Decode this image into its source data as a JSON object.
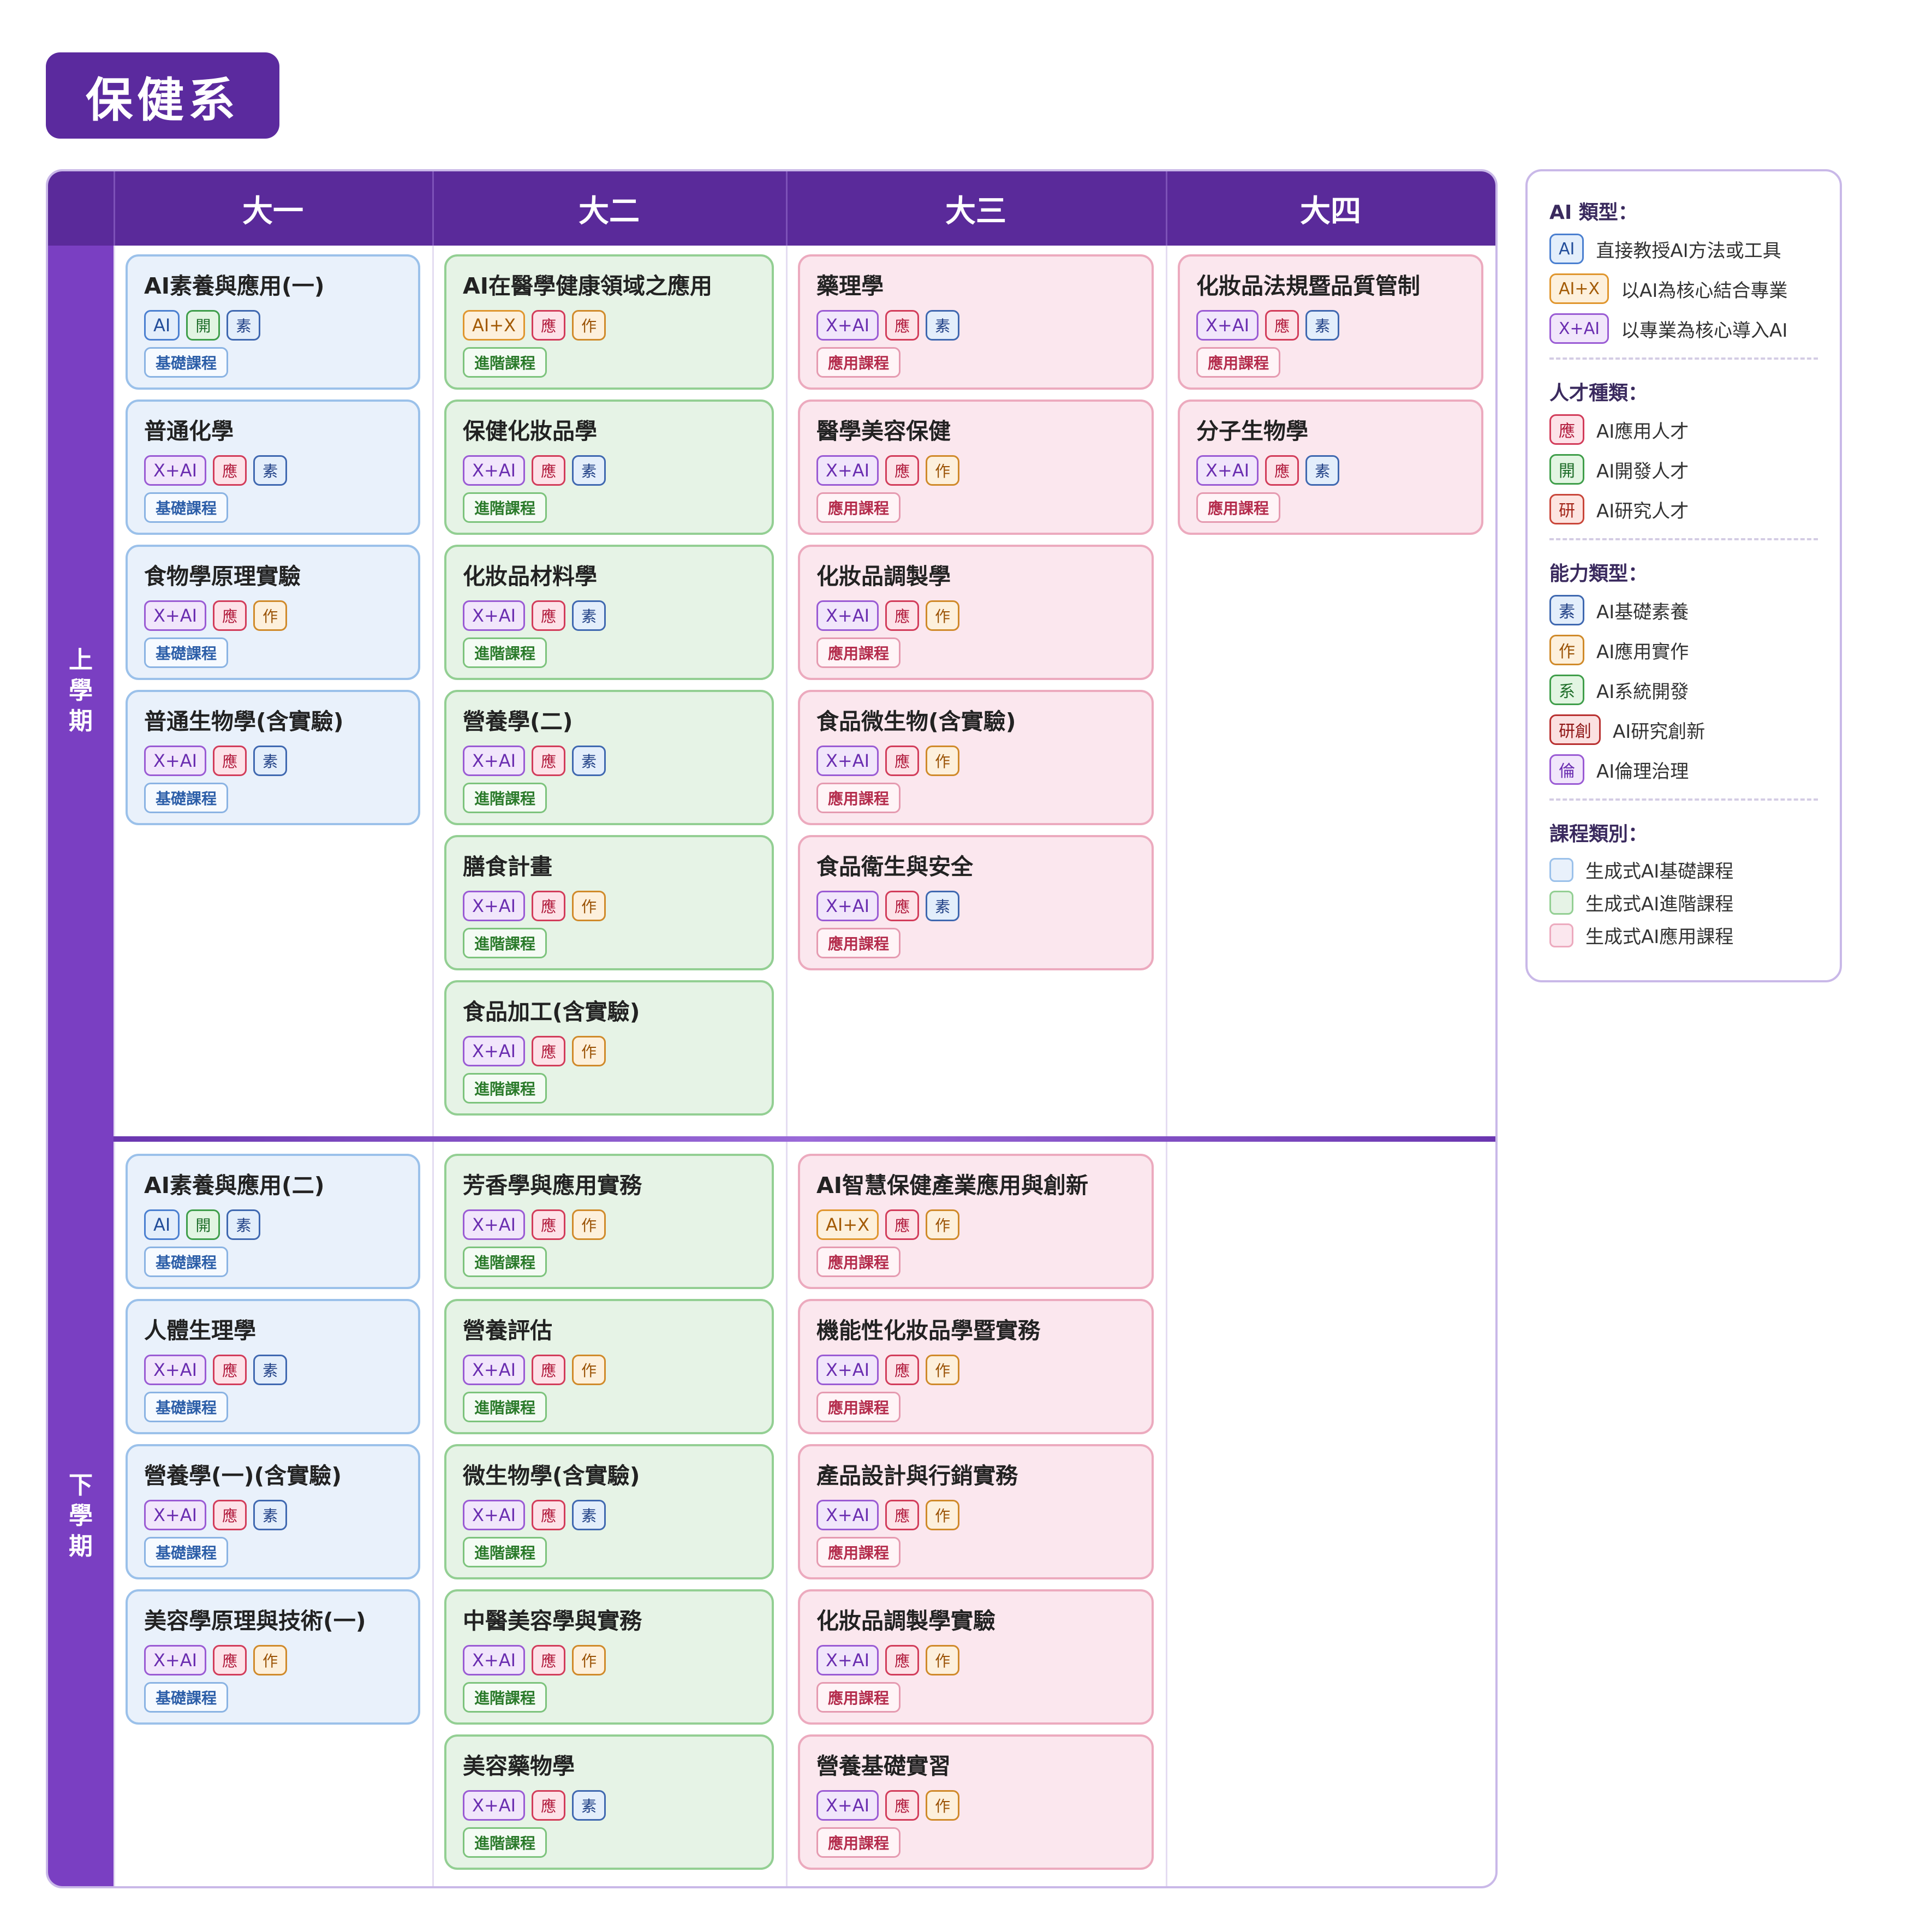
{
  "title": "保健系",
  "headers": {
    "corner": "",
    "years": [
      "大一",
      "大二",
      "大三",
      "大四"
    ]
  },
  "semesters": {
    "first": [
      "上",
      "學",
      "期"
    ],
    "second": [
      "下",
      "學",
      "期"
    ]
  },
  "course_type_labels": {
    "basic": "基礎課程",
    "adv": "進階課程",
    "app": "應用課程"
  },
  "columns": [
    {
      "year": "大一",
      "first": [
        {
          "title": "AI素養與應用(一)",
          "tags": [
            [
              "AI",
              "ai"
            ],
            [
              "開",
              "dev"
            ],
            [
              "素",
              "lit"
            ]
          ],
          "ctype": "basic"
        },
        {
          "title": "普通化學",
          "tags": [
            [
              "X+AI",
              "xai"
            ],
            [
              "應",
              "app"
            ],
            [
              "素",
              "lit"
            ]
          ],
          "ctype": "basic"
        },
        {
          "title": "食物學原理實驗",
          "tags": [
            [
              "X+AI",
              "xai"
            ],
            [
              "應",
              "app"
            ],
            [
              "作",
              "prac"
            ]
          ],
          "ctype": "basic"
        },
        {
          "title": "普通生物學(含實驗)",
          "tags": [
            [
              "X+AI",
              "xai"
            ],
            [
              "應",
              "app"
            ],
            [
              "素",
              "lit"
            ]
          ],
          "ctype": "basic"
        }
      ],
      "second": [
        {
          "title": "AI素養與應用(二)",
          "tags": [
            [
              "AI",
              "ai"
            ],
            [
              "開",
              "dev"
            ],
            [
              "素",
              "lit"
            ]
          ],
          "ctype": "basic"
        },
        {
          "title": "人體生理學",
          "tags": [
            [
              "X+AI",
              "xai"
            ],
            [
              "應",
              "app"
            ],
            [
              "素",
              "lit"
            ]
          ],
          "ctype": "basic"
        },
        {
          "title": "營養學(一)(含實驗)",
          "tags": [
            [
              "X+AI",
              "xai"
            ],
            [
              "應",
              "app"
            ],
            [
              "素",
              "lit"
            ]
          ],
          "ctype": "basic"
        },
        {
          "title": "美容學原理與技術(一)",
          "tags": [
            [
              "X+AI",
              "xai"
            ],
            [
              "應",
              "app"
            ],
            [
              "作",
              "prac"
            ]
          ],
          "ctype": "basic"
        }
      ]
    },
    {
      "year": "大二",
      "first": [
        {
          "title": "AI在醫學健康領域之應用",
          "tags": [
            [
              "AI+X",
              "aix"
            ],
            [
              "應",
              "app"
            ],
            [
              "作",
              "prac"
            ]
          ],
          "ctype": "adv"
        },
        {
          "title": "保健化妝品學",
          "tags": [
            [
              "X+AI",
              "xai"
            ],
            [
              "應",
              "app"
            ],
            [
              "素",
              "lit"
            ]
          ],
          "ctype": "adv"
        },
        {
          "title": "化妝品材料學",
          "tags": [
            [
              "X+AI",
              "xai"
            ],
            [
              "應",
              "app"
            ],
            [
              "素",
              "lit"
            ]
          ],
          "ctype": "adv"
        },
        {
          "title": "營養學(二)",
          "tags": [
            [
              "X+AI",
              "xai"
            ],
            [
              "應",
              "app"
            ],
            [
              "素",
              "lit"
            ]
          ],
          "ctype": "adv"
        },
        {
          "title": "膳食計畫",
          "tags": [
            [
              "X+AI",
              "xai"
            ],
            [
              "應",
              "app"
            ],
            [
              "作",
              "prac"
            ]
          ],
          "ctype": "adv"
        },
        {
          "title": "食品加工(含實驗)",
          "tags": [
            [
              "X+AI",
              "xai"
            ],
            [
              "應",
              "app"
            ],
            [
              "作",
              "prac"
            ]
          ],
          "ctype": "adv"
        }
      ],
      "second": [
        {
          "title": "芳香學與應用實務",
          "tags": [
            [
              "X+AI",
              "xai"
            ],
            [
              "應",
              "app"
            ],
            [
              "作",
              "prac"
            ]
          ],
          "ctype": "adv"
        },
        {
          "title": "營養評估",
          "tags": [
            [
              "X+AI",
              "xai"
            ],
            [
              "應",
              "app"
            ],
            [
              "作",
              "prac"
            ]
          ],
          "ctype": "adv"
        },
        {
          "title": "微生物學(含實驗)",
          "tags": [
            [
              "X+AI",
              "xai"
            ],
            [
              "應",
              "app"
            ],
            [
              "素",
              "lit"
            ]
          ],
          "ctype": "adv"
        },
        {
          "title": "中醫美容學與實務",
          "tags": [
            [
              "X+AI",
              "xai"
            ],
            [
              "應",
              "app"
            ],
            [
              "作",
              "prac"
            ]
          ],
          "ctype": "adv"
        },
        {
          "title": "美容藥物學",
          "tags": [
            [
              "X+AI",
              "xai"
            ],
            [
              "應",
              "app"
            ],
            [
              "素",
              "lit"
            ]
          ],
          "ctype": "adv"
        }
      ]
    },
    {
      "year": "大三",
      "first": [
        {
          "title": "藥理學",
          "tags": [
            [
              "X+AI",
              "xai"
            ],
            [
              "應",
              "app"
            ],
            [
              "素",
              "lit"
            ]
          ],
          "ctype": "app"
        },
        {
          "title": "醫學美容保健",
          "tags": [
            [
              "X+AI",
              "xai"
            ],
            [
              "應",
              "app"
            ],
            [
              "作",
              "prac"
            ]
          ],
          "ctype": "app"
        },
        {
          "title": "化妝品調製學",
          "tags": [
            [
              "X+AI",
              "xai"
            ],
            [
              "應",
              "app"
            ],
            [
              "作",
              "prac"
            ]
          ],
          "ctype": "app"
        },
        {
          "title": "食品微生物(含實驗)",
          "tags": [
            [
              "X+AI",
              "xai"
            ],
            [
              "應",
              "app"
            ],
            [
              "作",
              "prac"
            ]
          ],
          "ctype": "app"
        },
        {
          "title": "食品衛生與安全",
          "tags": [
            [
              "X+AI",
              "xai"
            ],
            [
              "應",
              "app"
            ],
            [
              "素",
              "lit"
            ]
          ],
          "ctype": "app"
        }
      ],
      "second": [
        {
          "title": "AI智慧保健產業應用與創新",
          "tags": [
            [
              "AI+X",
              "aix"
            ],
            [
              "應",
              "app"
            ],
            [
              "作",
              "prac"
            ]
          ],
          "ctype": "app"
        },
        {
          "title": "機能性化妝品學暨實務",
          "tags": [
            [
              "X+AI",
              "xai"
            ],
            [
              "應",
              "app"
            ],
            [
              "作",
              "prac"
            ]
          ],
          "ctype": "app"
        },
        {
          "title": "產品設計與行銷實務",
          "tags": [
            [
              "X+AI",
              "xai"
            ],
            [
              "應",
              "app"
            ],
            [
              "作",
              "prac"
            ]
          ],
          "ctype": "app"
        },
        {
          "title": "化妝品調製學實驗",
          "tags": [
            [
              "X+AI",
              "xai"
            ],
            [
              "應",
              "app"
            ],
            [
              "作",
              "prac"
            ]
          ],
          "ctype": "app"
        },
        {
          "title": "營養基礎實習",
          "tags": [
            [
              "X+AI",
              "xai"
            ],
            [
              "應",
              "app"
            ],
            [
              "作",
              "prac"
            ]
          ],
          "ctype": "app"
        }
      ]
    },
    {
      "year": "大四",
      "first": [
        {
          "title": "化妝品法規暨品質管制",
          "tags": [
            [
              "X+AI",
              "xai"
            ],
            [
              "應",
              "app"
            ],
            [
              "素",
              "lit"
            ]
          ],
          "ctype": "app"
        },
        {
          "title": "分子生物學",
          "tags": [
            [
              "X+AI",
              "xai"
            ],
            [
              "應",
              "app"
            ],
            [
              "素",
              "lit"
            ]
          ],
          "ctype": "app"
        }
      ],
      "second": []
    }
  ],
  "legend": {
    "ai_type": {
      "title": "AI 類型：",
      "items": [
        {
          "tag": "AI",
          "cls": "ai",
          "text": "直接教授AI方法或工具"
        },
        {
          "tag": "AI+X",
          "cls": "aix",
          "text": "以AI為核心結合專業"
        },
        {
          "tag": "X+AI",
          "cls": "xai",
          "text": "以專業為核心導入AI"
        }
      ]
    },
    "talent": {
      "title": "人才種類：",
      "items": [
        {
          "tag": "應",
          "cls": "app",
          "text": "AI應用人才"
        },
        {
          "tag": "開",
          "cls": "dev",
          "text": "AI開發人才"
        },
        {
          "tag": "研",
          "cls": "res",
          "text": "AI研究人才"
        }
      ]
    },
    "ability": {
      "title": "能力類型：",
      "items": [
        {
          "tag": "素",
          "cls": "lit",
          "text": "AI基礎素養"
        },
        {
          "tag": "作",
          "cls": "prac",
          "text": "AI應用實作"
        },
        {
          "tag": "系",
          "cls": "sys",
          "text": "AI系統開發"
        },
        {
          "tag": "研創",
          "cls": "inn",
          "text": "AI研究創新"
        },
        {
          "tag": "倫",
          "cls": "eth",
          "text": "AI倫理治理"
        }
      ]
    },
    "course": {
      "title": "課程類別：",
      "items": [
        {
          "swatch": "basic",
          "text": "生成式AI基礎課程"
        },
        {
          "swatch": "adv",
          "text": "生成式AI進階課程"
        },
        {
          "swatch": "app",
          "text": "生成式AI應用課程"
        }
      ]
    }
  },
  "colors": {
    "header": "#5a2a9a",
    "sidebar": "#7a3fc2",
    "basic_fill": "#e9f1fb",
    "adv_fill": "#e6f3e6",
    "app_fill": "#fbe7ee"
  }
}
